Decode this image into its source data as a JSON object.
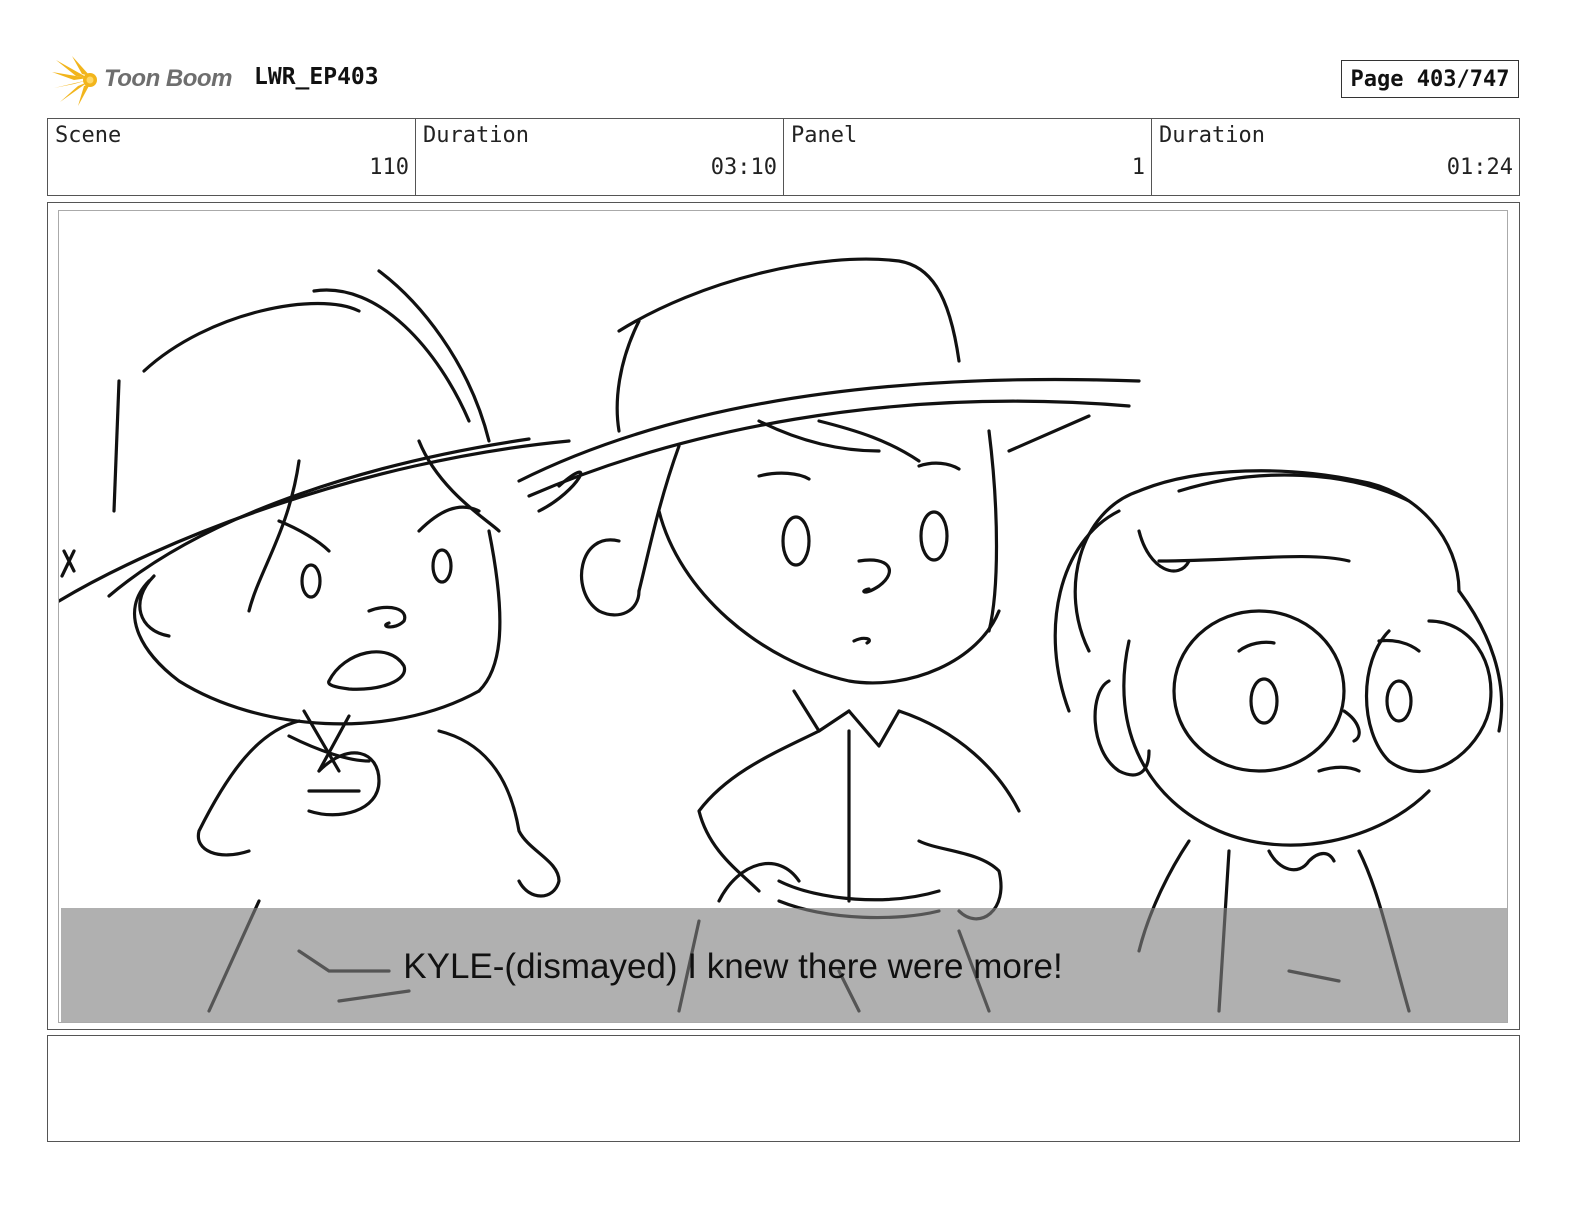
{
  "header": {
    "logo_text": "Toon Boom",
    "logo_icon": "toon-boom-starburst-icon",
    "project": "LWR_EP403",
    "page": "Page 403/747"
  },
  "info": {
    "scene_label": "Scene",
    "scene_value": "110",
    "scene_duration_label": "Duration",
    "scene_duration_value": "03:10",
    "panel_label": "Panel",
    "panel_value": "1",
    "panel_duration_label": "Duration",
    "panel_duration_value": "01:24"
  },
  "panel": {
    "caption": "KYLE-(dismayed) I knew there were more!"
  },
  "colors": {
    "logo_yellow": "#f2b51c",
    "logo_text": "#6e6e6e",
    "caption_bar": "#808080"
  }
}
